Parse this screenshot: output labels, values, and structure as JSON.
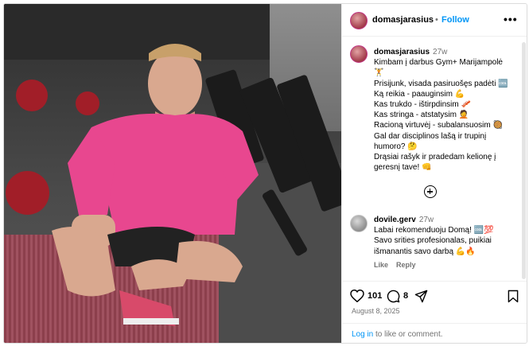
{
  "post": {
    "username": "domasjarasius",
    "separator": "•",
    "follow_label": "Follow",
    "more_label": "•••"
  },
  "caption": {
    "username": "domasjarasius",
    "time": "27w",
    "lines": [
      "Kimbam į darbus Gym+ Marijampolė",
      "🏋",
      "Prisijunk, visada pasiruošęs padėti 🆒",
      "Ką reikia - paauginsim 💪",
      "Kas trukdo - ištirpdinsim 🥓",
      "Kas stringa - atstatysim 🤦",
      "Racioną virtuvėj - subalansuosim 🥘",
      "Gal dar disciplinos lašą ir trupinį",
      "humoro? 🤔",
      "Drąsiai rašyk ir pradedam kelionę į",
      "geresnį tave! 👊"
    ]
  },
  "comment": {
    "username": "dovile.gerv",
    "time": "27w",
    "lines": [
      "Labai rekomenduoju Domą! 🆒💯",
      "Savo srities profesionalas, puikiai",
      "išmanantis savo darbą 💪🔥"
    ],
    "like_label": "Like",
    "reply_label": "Reply"
  },
  "actions": {
    "likes": "101",
    "comments": "8",
    "date": "August 8, 2025"
  },
  "login": {
    "link_label": "Log in",
    "rest": " to like or comment."
  },
  "colors": {
    "accent": "#0095f6",
    "muted": "#737373",
    "border": "#dbdbdb"
  }
}
